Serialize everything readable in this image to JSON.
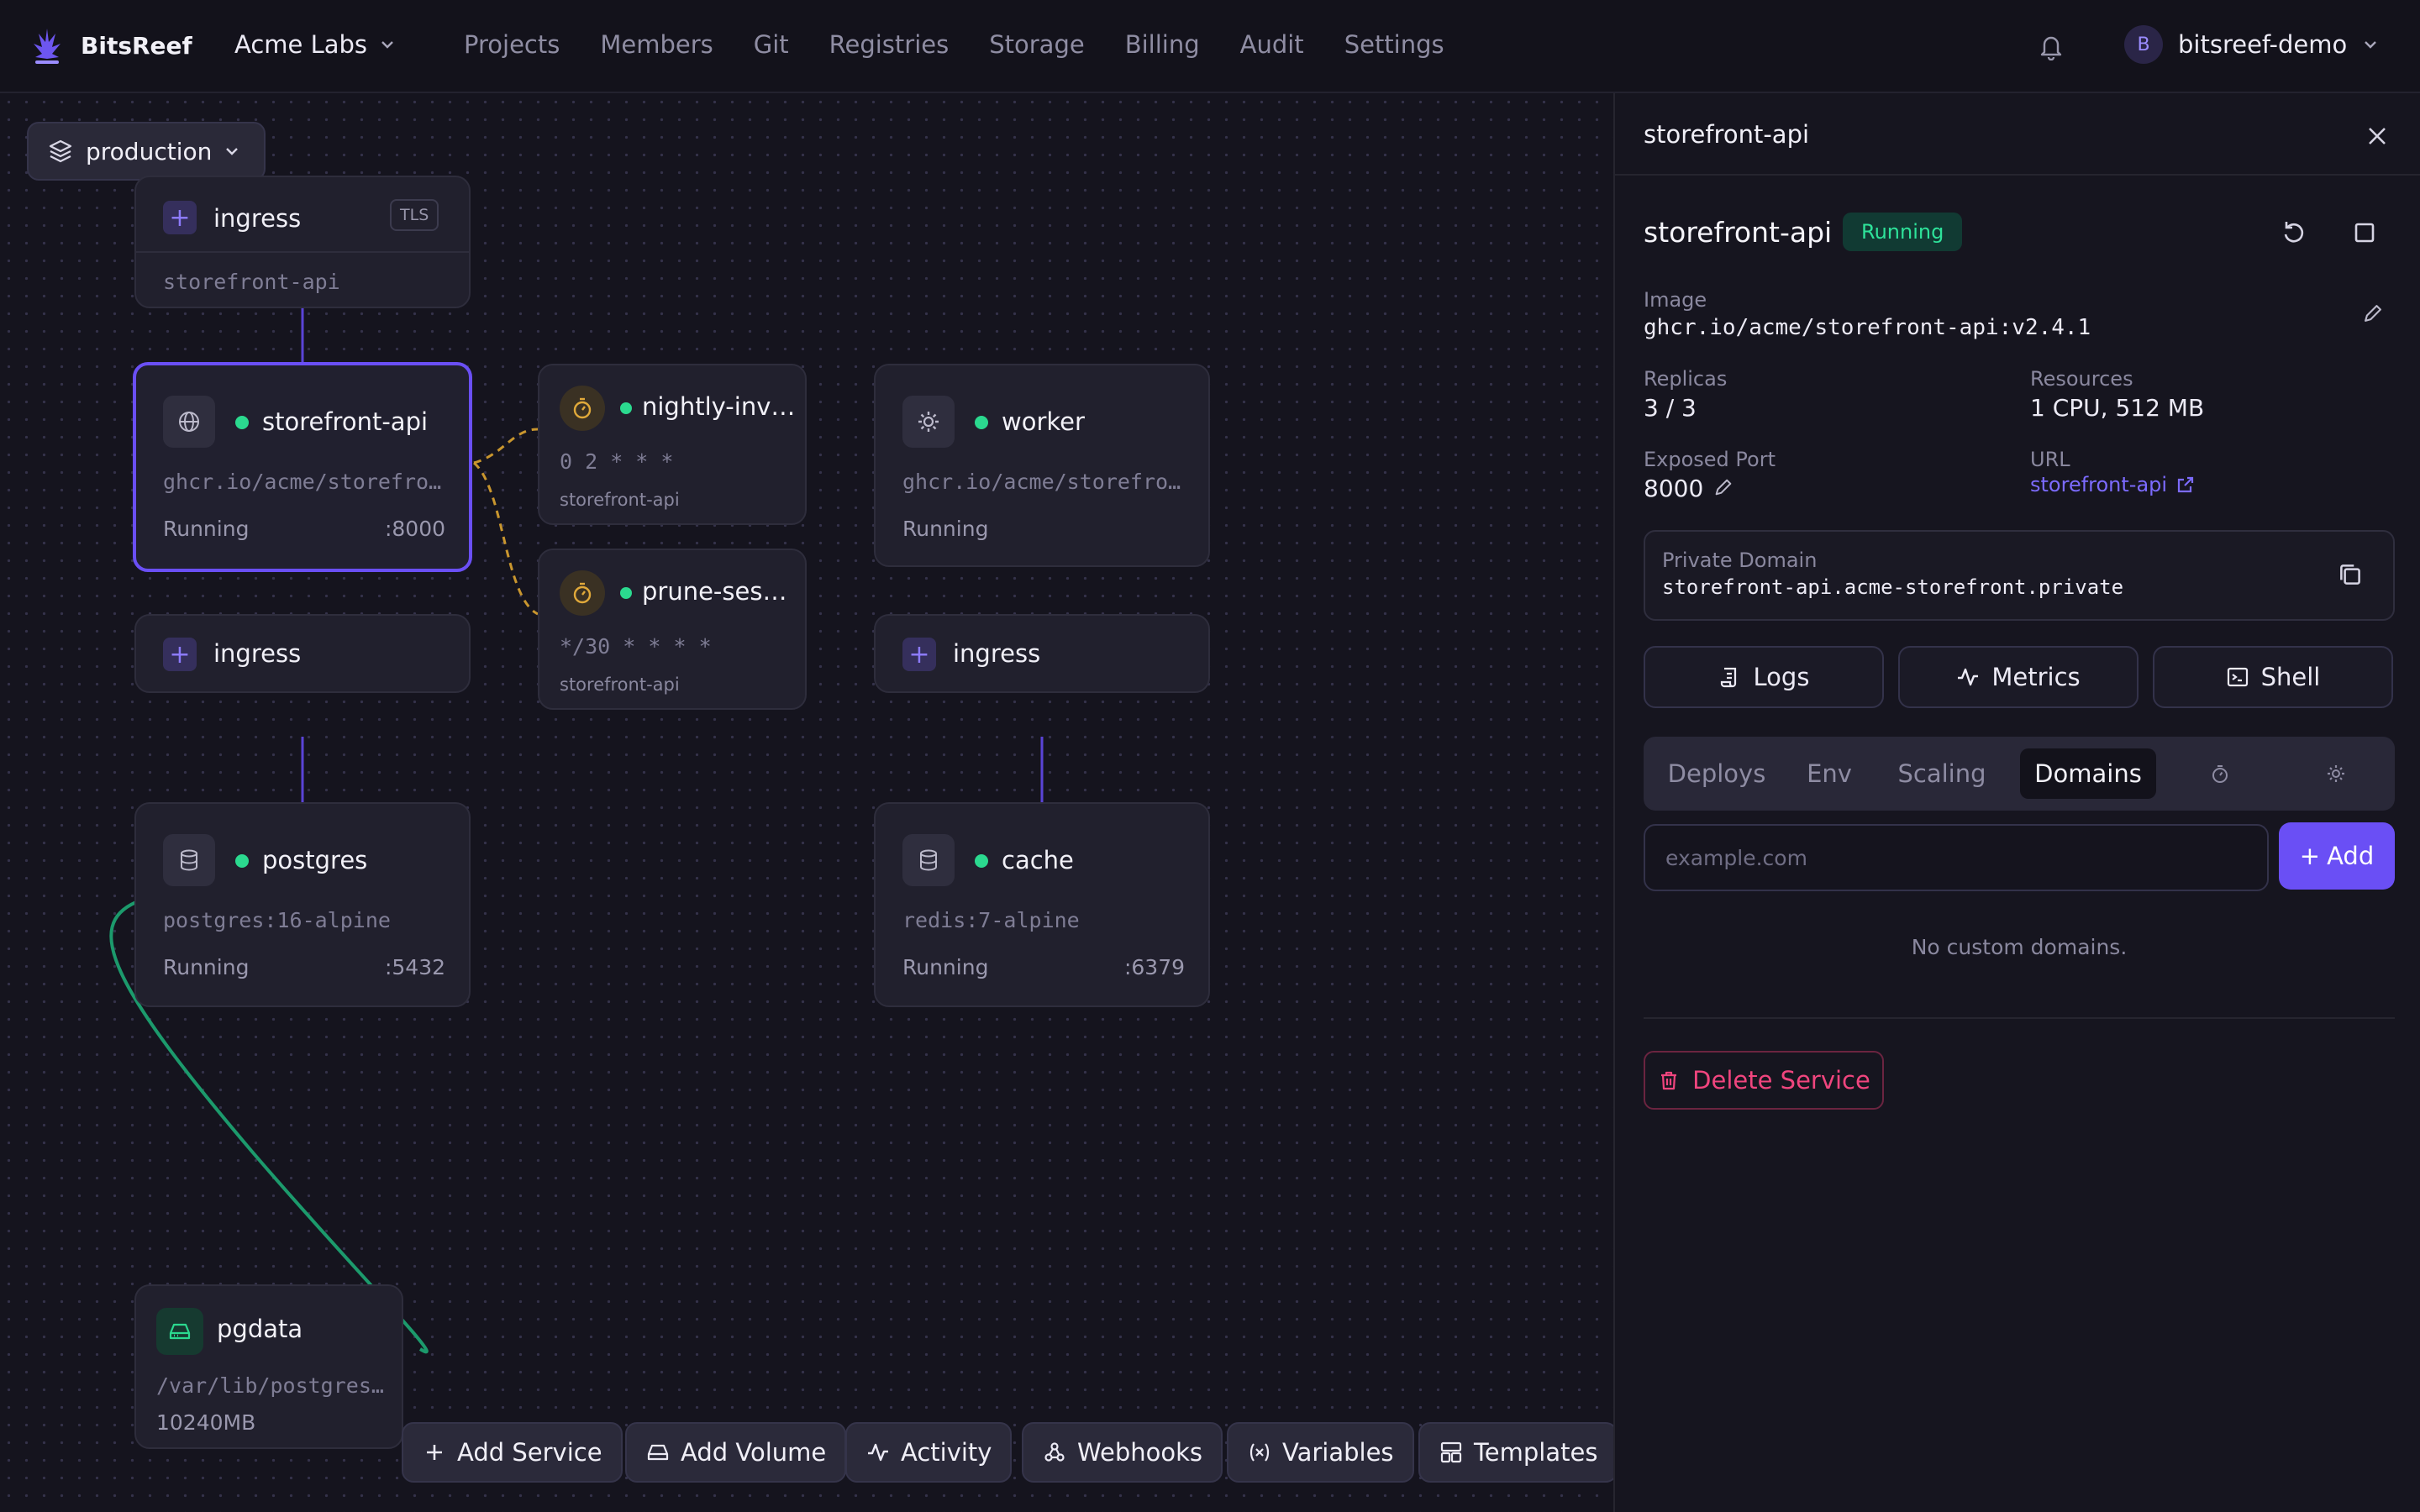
{
  "nav": {
    "brand": "BitsReef",
    "org": "Acme Labs",
    "links": [
      "Projects",
      "Members",
      "Git",
      "Registries",
      "Storage",
      "Billing",
      "Audit",
      "Settings"
    ],
    "user": {
      "initial": "B",
      "name": "bitsreef-demo"
    }
  },
  "canvas": {
    "environment": "production",
    "nodes": {
      "ingress_top": {
        "label": "ingress",
        "badge": "TLS",
        "target": "storefront-api"
      },
      "storefront": {
        "name": "storefront-api",
        "image": "ghcr.io/acme/storefro…",
        "status": "Running",
        "port": ":8000"
      },
      "nightly": {
        "name": "nightly-inv…",
        "schedule": "0 2 * * *",
        "target": "storefront-api"
      },
      "prune": {
        "name": "prune-ses…",
        "schedule": "*/30 * * * *",
        "target": "storefront-api"
      },
      "worker": {
        "name": "worker",
        "image": "ghcr.io/acme/storefro…",
        "status": "Running"
      },
      "ingress_left": {
        "label": "ingress"
      },
      "ingress_right": {
        "label": "ingress"
      },
      "postgres": {
        "name": "postgres",
        "image": "postgres:16-alpine",
        "status": "Running",
        "port": ":5432"
      },
      "cache": {
        "name": "cache",
        "image": "redis:7-alpine",
        "status": "Running",
        "port": ":6379"
      },
      "pgdata": {
        "name": "pgdata",
        "path": "/var/lib/postgres…",
        "size": "10240MB"
      }
    },
    "toolbar": [
      "Add Service",
      "Add Volume",
      "Activity",
      "Webhooks",
      "Variables",
      "Templates"
    ]
  },
  "panel": {
    "header": "storefront-api",
    "service": "storefront-api",
    "status": "Running",
    "image_label": "Image",
    "image": "ghcr.io/acme/storefront-api:v2.4.1",
    "replicas_label": "Replicas",
    "replicas": "3 / 3",
    "resources_label": "Resources",
    "resources": "1 CPU, 512 MB",
    "port_label": "Exposed Port",
    "port": "8000",
    "url_label": "URL",
    "url": "storefront-api",
    "private_domain_label": "Private Domain",
    "private_domain": "storefront-api.acme-storefront.private",
    "actions": [
      "Logs",
      "Metrics",
      "Shell"
    ],
    "tabs": [
      "Deploys",
      "Env",
      "Scaling",
      "Domains"
    ],
    "domain_placeholder": "example.com",
    "add_label": "Add",
    "empty": "No custom domains.",
    "delete_label": "Delete Service"
  },
  "colors": {
    "accent": "#6a4ff5",
    "running": "#2bd98f",
    "cron": "#e0a93a",
    "danger": "#f0457e"
  }
}
